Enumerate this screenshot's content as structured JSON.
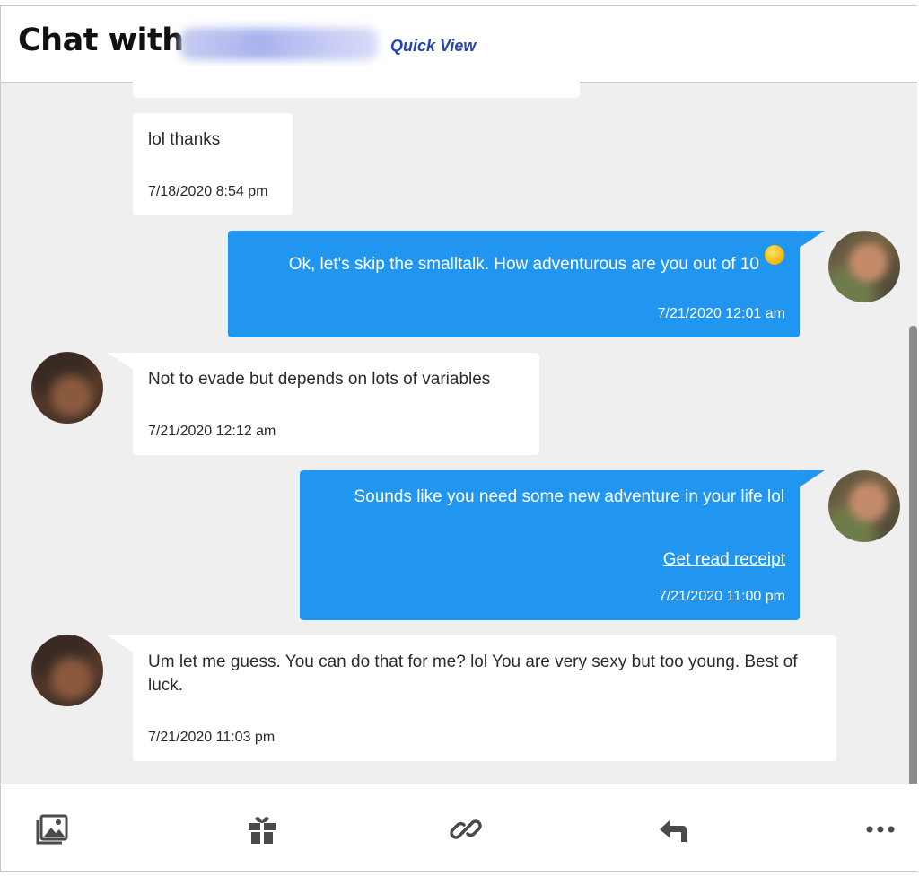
{
  "header": {
    "title": "Chat with",
    "quick_view": "Quick View"
  },
  "messages": [
    {
      "direction": "incoming",
      "text": "lol thanks",
      "timestamp": "7/18/2020 8:54 pm"
    },
    {
      "direction": "outgoing",
      "text": "Ok, let's skip the smalltalk. How adventurous are you out of 10",
      "emoji": "smiley-emoji",
      "timestamp": "7/21/2020 12:01 am"
    },
    {
      "direction": "incoming",
      "text": "Not to evade but depends on lots of variables",
      "timestamp": "7/21/2020 12:12 am"
    },
    {
      "direction": "outgoing",
      "text": "Sounds like you need some new adventure in your life lol",
      "link": "Get read receipt",
      "timestamp": "7/21/2020 11:00 pm"
    },
    {
      "direction": "incoming",
      "text": "Um let me guess. You can do that for me? lol You are very sexy but too young. Best of luck.",
      "timestamp": "7/21/2020 11:03 pm"
    }
  ],
  "toolbar": {
    "icons": [
      "photo-icon",
      "gift-icon",
      "link-icon",
      "reply-icon",
      "more-icon"
    ]
  },
  "colors": {
    "outgoing_bubble": "#2196f0",
    "incoming_bubble": "#ffffff",
    "background": "#efefef",
    "link": "#2346a8"
  }
}
